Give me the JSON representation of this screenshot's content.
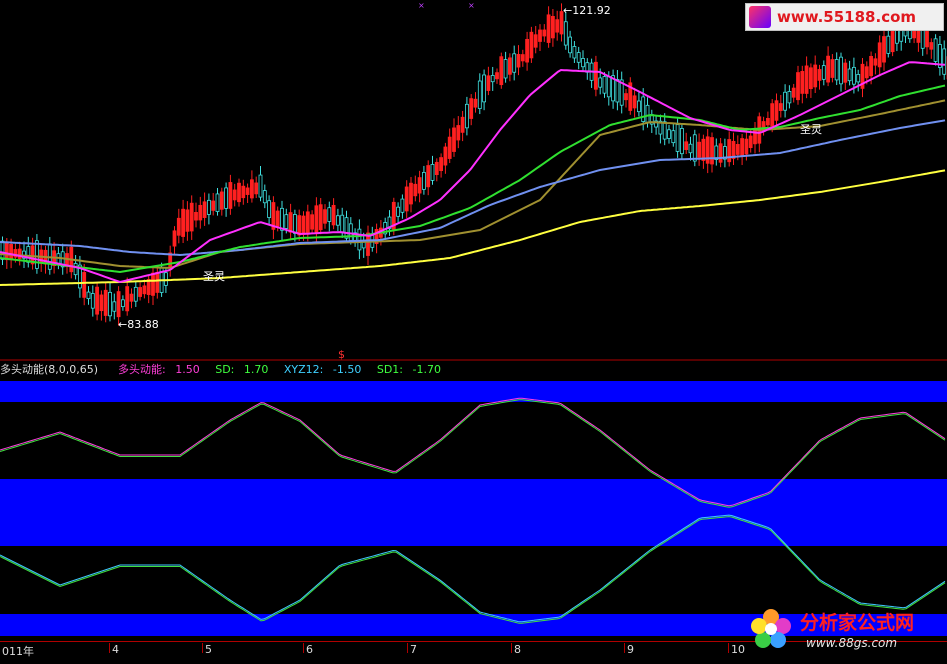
{
  "indicator": {
    "title": "多头动能(8,0,0,65)",
    "values": [
      {
        "label": "多头动能:",
        "value": "1.50",
        "color": "#ff3fd9"
      },
      {
        "label": "SD:",
        "value": "1.70",
        "color": "#3fff3f"
      },
      {
        "label": "XYZ12:",
        "value": "-1.50",
        "color": "#3fd0ff"
      },
      {
        "label": "SD1:",
        "value": "-1.70",
        "color": "#3fff3f"
      }
    ]
  },
  "price_labels": {
    "high": "121.92",
    "low": "83.88"
  },
  "signals": [
    "圣灵",
    "圣灵"
  ],
  "marker": "$",
  "xaxis": {
    "ticks": [
      "011年",
      "4",
      "5",
      "6",
      "7",
      "8",
      "9",
      "10"
    ]
  },
  "watermarks": {
    "top": "www.55188.com",
    "bottom_name": "分析家公式网",
    "bottom_url": "www.88gs.com"
  },
  "colors": {
    "up": "#ff2020",
    "down": "#40e0e0",
    "ma_magenta": "#ff30ff",
    "ma_green": "#30e030",
    "ma_olive": "#a09030",
    "ma_lightblue": "#7090f0",
    "ma_yellow": "#ffff40",
    "band": "#0000ff"
  }
}
